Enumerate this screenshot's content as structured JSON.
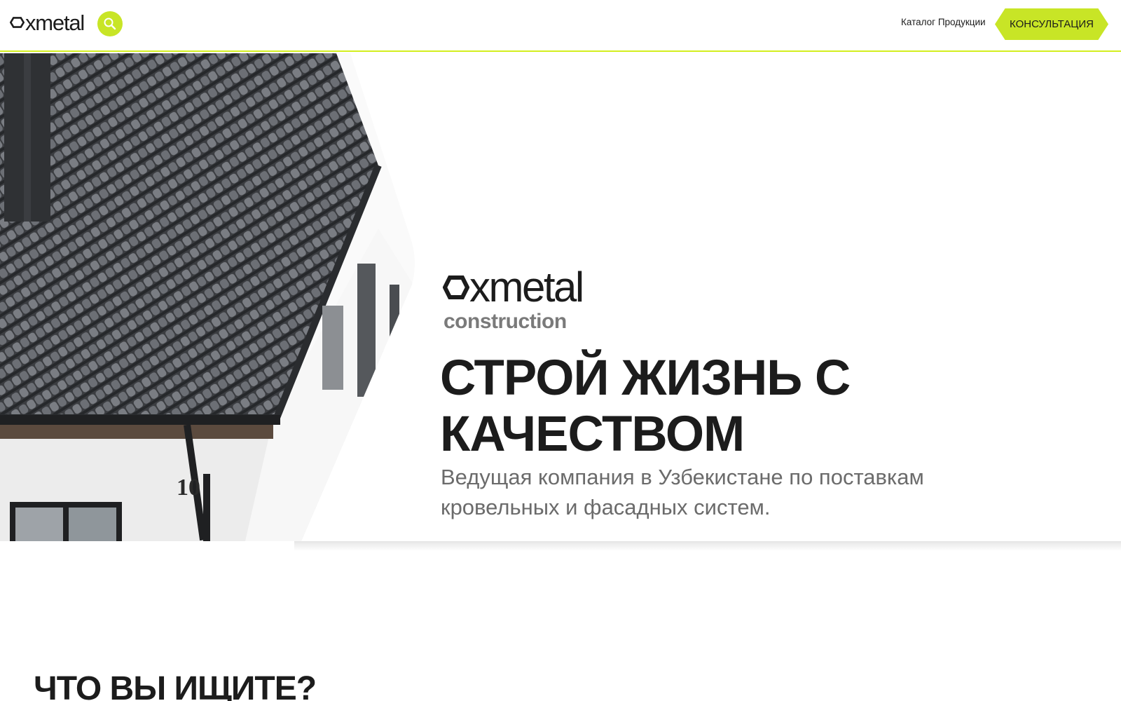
{
  "header": {
    "logo_text": "xmetal",
    "nav_catalog": "Каталог Продукции",
    "consult_label": "КОНСУЛЬТАЦИЯ"
  },
  "hero": {
    "brand_word": "xmetal",
    "brand_sub": "construction",
    "title_line1": "СТРОЙ ЖИЗНЬ С",
    "title_line2": "КАЧЕСТВОМ",
    "subtitle_line1": "Ведущая компания в Узбекистане по поставкам",
    "subtitle_line2": "кровельных и фасадных систем.",
    "house_number": "10"
  },
  "section": {
    "title": "ЧТО ВЫ ИЩИТЕ?"
  },
  "colors": {
    "accent": "#c8e526",
    "text": "#1c1c1c",
    "muted": "#6b6b6b"
  }
}
